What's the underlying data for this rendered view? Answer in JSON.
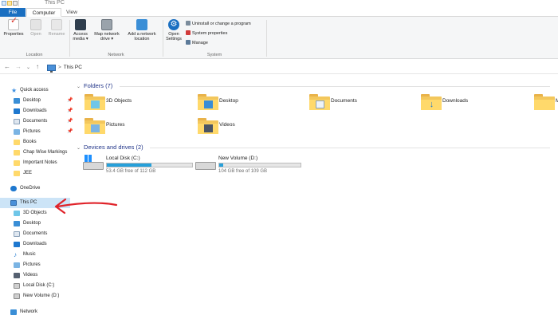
{
  "window": {
    "title": "This PC"
  },
  "ribbon": {
    "tabs": [
      "File",
      "Computer",
      "View"
    ],
    "buttons": {
      "properties": "Properties",
      "open": "Open",
      "rename": "Rename",
      "access_media": "Access media ▾",
      "map_network_drive": "Map network drive ▾",
      "add_network_location": "Add a network location",
      "open_settings": "Open Settings",
      "uninstall": "Uninstall or change a program",
      "system_properties": "System properties",
      "manage": "Manage"
    },
    "groups": {
      "location": "Location",
      "network": "Network",
      "system": "System"
    }
  },
  "address": {
    "path": "This PC",
    "separator": ">"
  },
  "sidebar": {
    "quick_access": "Quick access",
    "quick_items": [
      "Desktop",
      "Downloads",
      "Documents",
      "Pictures",
      "Books",
      "Chap Wise Markings",
      "Important Notes",
      "JEE"
    ],
    "onedrive": "OneDrive",
    "this_pc": "This PC",
    "pc_items": [
      "3D Objects",
      "Desktop",
      "Documents",
      "Downloads",
      "Music",
      "Pictures",
      "Videos",
      "Local Disk (C:)",
      "New Volume (D:)"
    ],
    "network": "Network"
  },
  "main": {
    "folders_header": "Folders (7)",
    "folders": [
      "3D Objects",
      "Desktop",
      "Documents",
      "Downloads",
      "M",
      "Pictures",
      "Videos"
    ],
    "drives_header": "Devices and drives (2)",
    "drives": [
      {
        "name": "Local Disk (C:)",
        "free": "53.4 GB free of 112 GB",
        "used_fraction": 0.52
      },
      {
        "name": "New Volume (D:)",
        "free": "104 GB free of 109 GB",
        "used_fraction": 0.05
      }
    ]
  },
  "colors": {
    "accent": "#1a6fc1",
    "folder": "#ffd96b",
    "selection": "#cce4f7",
    "annotation": "#e0232a",
    "drive_bar": "#26a0da"
  }
}
